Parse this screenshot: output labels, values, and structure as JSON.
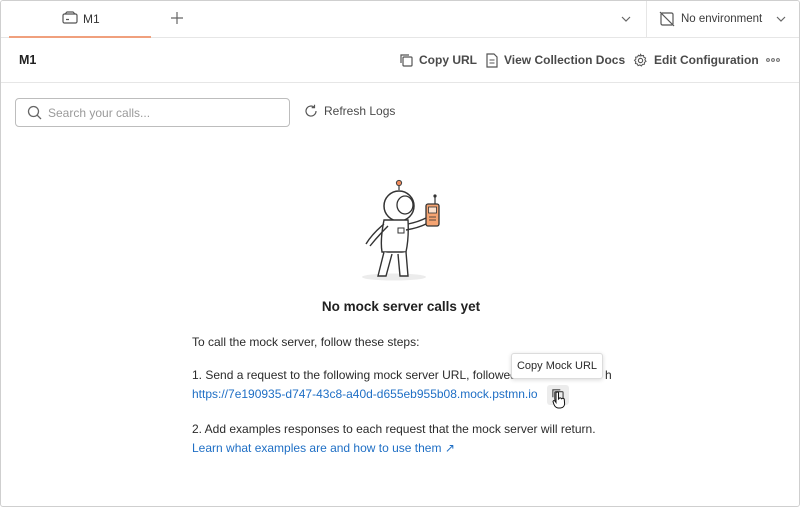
{
  "tabbar": {
    "tab_label": "M1",
    "environment": "No environment"
  },
  "header": {
    "title": "M1",
    "copy_url": "Copy URL",
    "view_docs": "View Collection Docs",
    "edit_config": "Edit Configuration"
  },
  "search": {
    "placeholder": "Search your calls...",
    "refresh_label": "Refresh Logs"
  },
  "empty_state": {
    "title": "No mock server calls yet",
    "intro": "To call the mock server, follow these steps:",
    "step1_text": "1. Send a request to the following mock server URL, followed b",
    "step1_tail": "h",
    "mock_url": "https://7e190935-d747-43c8-a40d-d655eb955b08.mock.pstmn.io",
    "tooltip": "Copy Mock URL",
    "step2_text": "2. Add examples responses to each request that the mock server will return.",
    "learn_link": "Learn what examples are and how to use them ↗"
  },
  "colors": {
    "accent": "#f0a07d",
    "link": "#1f6fc5"
  }
}
